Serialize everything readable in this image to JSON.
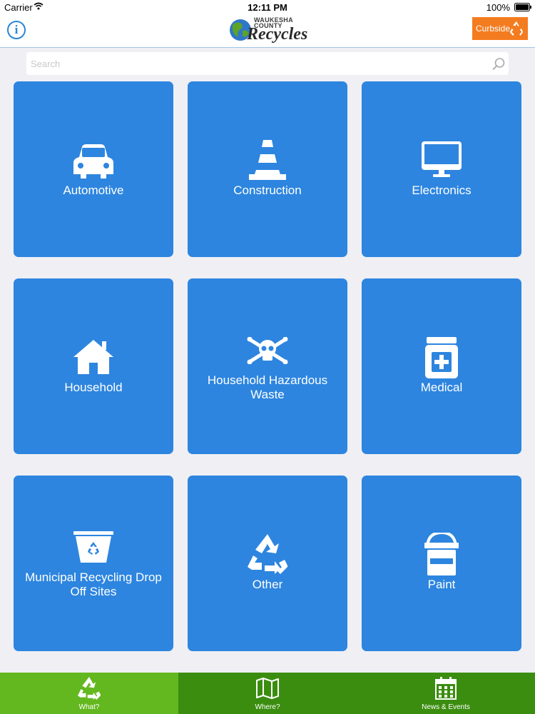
{
  "status_bar": {
    "carrier": "Carrier",
    "time": "12:11 PM",
    "battery": "100%"
  },
  "nav": {
    "info_label": "i",
    "logo_top": "WAUKESHA COUNTY",
    "logo_main": "Recycles",
    "curbside_label": "Curbside"
  },
  "search": {
    "placeholder": "Search"
  },
  "categories": [
    {
      "label": "Automotive",
      "icon": "car-icon"
    },
    {
      "label": "Construction",
      "icon": "traffic-cone-icon"
    },
    {
      "label": "Electronics",
      "icon": "monitor-icon"
    },
    {
      "label": "Household",
      "icon": "house-icon"
    },
    {
      "label": "Household Hazardous Waste",
      "icon": "skull-crossbones-icon"
    },
    {
      "label": "Medical",
      "icon": "medicine-bottle-icon"
    },
    {
      "label": "Municipal Recycling Drop Off Sites",
      "icon": "recycling-bin-icon"
    },
    {
      "label": "Other",
      "icon": "recycle-icon"
    },
    {
      "label": "Paint",
      "icon": "paint-can-icon"
    }
  ],
  "tabs": [
    {
      "label": "What?",
      "icon": "recycle-icon",
      "active": true
    },
    {
      "label": "Where?",
      "icon": "map-icon",
      "active": false
    },
    {
      "label": "News & Events",
      "icon": "calendar-icon",
      "active": false
    }
  ],
  "colors": {
    "tile_blue": "#2d85df",
    "curbside_orange": "#f47c20",
    "tab_green": "#3b8d10",
    "tab_active_green": "#63b81f",
    "accent_blue": "#2a86d8"
  }
}
